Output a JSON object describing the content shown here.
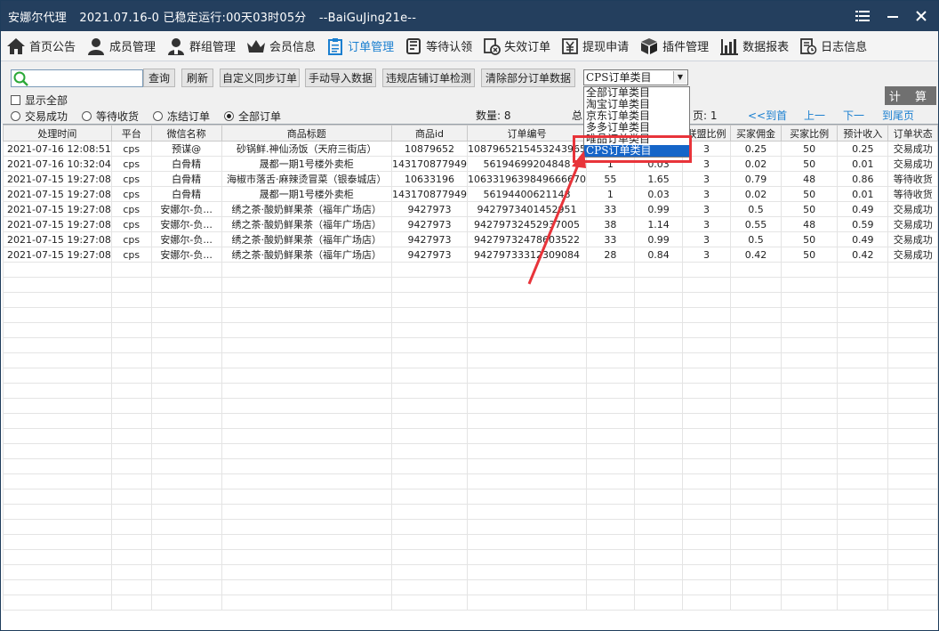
{
  "titlebar": {
    "app_name": "安娜尔代理",
    "status": "2021.07.16-0 已稳定运行:00天03时05分",
    "user": "--BaiGuJing21e--"
  },
  "tabs": [
    {
      "label": "首页公告",
      "icon": "home-icon"
    },
    {
      "label": "成员管理",
      "icon": "person-icon"
    },
    {
      "label": "群组管理",
      "icon": "group-icon"
    },
    {
      "label": "会员信息",
      "icon": "crown-icon"
    },
    {
      "label": "订单管理",
      "icon": "clipboard-icon",
      "active": true
    },
    {
      "label": "等待认领",
      "icon": "hourglass-icon"
    },
    {
      "label": "失效订单",
      "icon": "invalid-order-icon"
    },
    {
      "label": "提现申请",
      "icon": "withdraw-icon"
    },
    {
      "label": "插件管理",
      "icon": "cube-icon"
    },
    {
      "label": "数据报表",
      "icon": "bar-chart-icon"
    },
    {
      "label": "日志信息",
      "icon": "log-icon"
    }
  ],
  "toolbar": {
    "search_value": "",
    "query": "查询",
    "refresh": "刷新",
    "custom_sync": "自定义同步订单",
    "manual_import": "手动导入数据",
    "violation_check": "违规店铺订单检测",
    "clear_partial": "清除部分订单数据",
    "select_value": "CPS订单类目",
    "show_all": "显示全部",
    "calc": "计 算"
  },
  "dropdown_options": [
    "全部订单类目",
    "淘宝订单类目",
    "京东订单类目",
    "多多订单类目",
    "唯品订单类目",
    "CPS订单类目"
  ],
  "filters": {
    "radios": [
      "交易成功",
      "等待收货",
      "冻结订单",
      "全部订单"
    ],
    "selected": "全部订单"
  },
  "stats": {
    "count": "数量: 8",
    "total_prefix": "总",
    "page_suffix": "页: 1"
  },
  "pager": {
    "first": "<<到首页",
    "prev": "上一页",
    "next": "下一页",
    "last": "到尾页>>"
  },
  "table": {
    "headers": [
      "处理时间",
      "平台",
      "微信名称",
      "商品标题",
      "商品id",
      "订单编号",
      "",
      "",
      "联盟比例",
      "买家佣金",
      "买家比例",
      "预计收入",
      "订单状态"
    ],
    "rows": [
      [
        "2021-07-16 12:08:51",
        "cps",
        "预谋@",
        "砂锅鲜.神仙汤饭（天府三街店）",
        "10879652",
        "1087965215453243965",
        "",
        "",
        "3",
        "0.25",
        "50",
        "0.25",
        "交易成功"
      ],
      [
        "2021-07-16 10:32:04",
        "cps",
        "白骨精",
        "晟都一期1号楼外卖柜",
        "143170877949",
        "56194699204848",
        "1",
        "0.03",
        "3",
        "0.02",
        "50",
        "0.01",
        "交易成功"
      ],
      [
        "2021-07-15 19:27:08",
        "cps",
        "白骨精",
        "海椒市落舌·麻辣烫冒菜（银泰城店）",
        "10633196",
        "1063319639849666670",
        "55",
        "1.65",
        "3",
        "0.79",
        "48",
        "0.86",
        "等待收货"
      ],
      [
        "2021-07-15 19:27:08",
        "cps",
        "白骨精",
        "晟都一期1号楼外卖柜",
        "143170877949",
        "56194400621148",
        "1",
        "0.03",
        "3",
        "0.02",
        "50",
        "0.01",
        "等待收货"
      ],
      [
        "2021-07-15 19:27:08",
        "cps",
        "安娜尔-负...",
        "绣之茶·酸奶鲜果茶（福年广场店）",
        "9427973",
        "9427973401452951",
        "33",
        "0.99",
        "3",
        "0.5",
        "50",
        "0.49",
        "交易成功"
      ],
      [
        "2021-07-15 19:27:08",
        "cps",
        "安娜尔-负...",
        "绣之茶·酸奶鲜果茶（福年广场店）",
        "9427973",
        "94279732452937005",
        "38",
        "1.14",
        "3",
        "0.55",
        "48",
        "0.59",
        "交易成功"
      ],
      [
        "2021-07-15 19:27:08",
        "cps",
        "安娜尔-负...",
        "绣之茶·酸奶鲜果茶（福年广场店）",
        "9427973",
        "94279732478603522",
        "33",
        "0.99",
        "3",
        "0.5",
        "50",
        "0.49",
        "交易成功"
      ],
      [
        "2021-07-15 19:27:08",
        "cps",
        "安娜尔-负...",
        "绣之茶·酸奶鲜果茶（福年广场店）",
        "9427973",
        "94279733312309084",
        "28",
        "0.84",
        "3",
        "0.42",
        "50",
        "0.42",
        "交易成功"
      ]
    ]
  },
  "colors": {
    "titlebar": "#243f5e",
    "accent": "#1a7fd0",
    "annotation": "#e8343a",
    "selection": "#1565c8"
  }
}
